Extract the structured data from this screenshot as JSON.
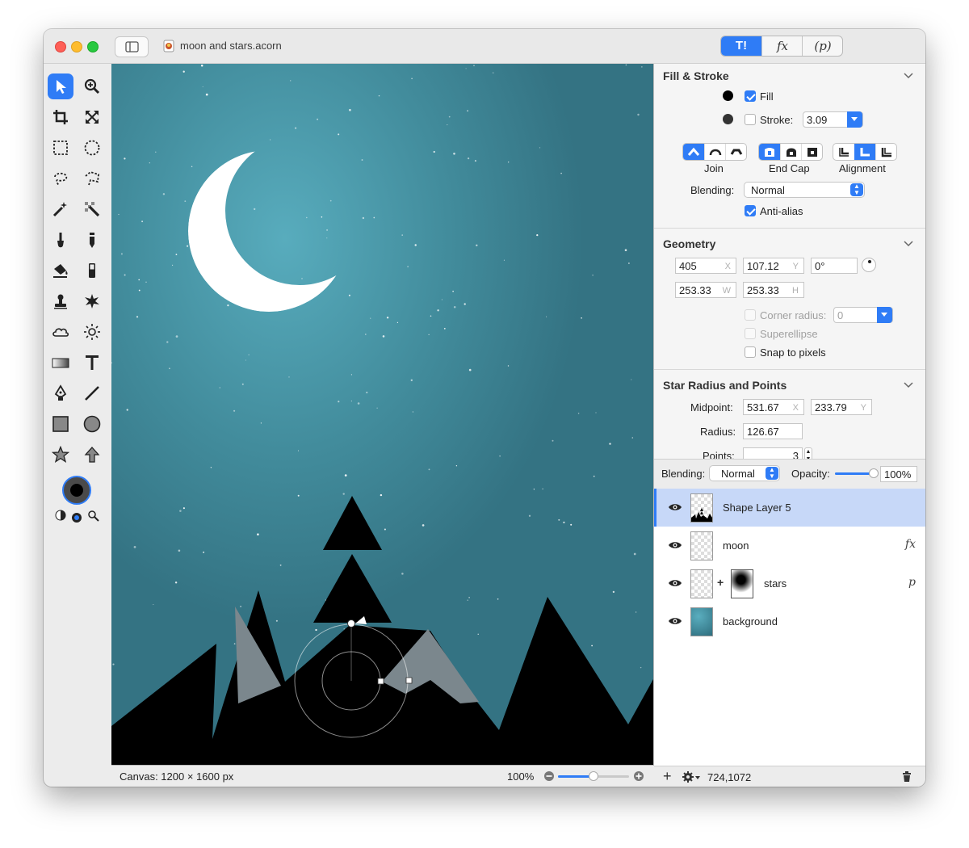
{
  "window": {
    "title": "moon and stars.acorn",
    "mode_tabs": [
      "T!",
      "fx",
      "(p)"
    ]
  },
  "tools": [
    {
      "name": "select-tool",
      "icon": "arrow-pointer-icon",
      "selected": true
    },
    {
      "name": "zoom-tool",
      "icon": "magnifier-plus-icon"
    },
    {
      "name": "crop-tool",
      "icon": "crop-icon"
    },
    {
      "name": "transform-tool",
      "icon": "expand-arrows-icon"
    },
    {
      "name": "rect-select-tool",
      "icon": "dashed-rectangle-icon"
    },
    {
      "name": "ellipse-select-tool",
      "icon": "dashed-circle-icon"
    },
    {
      "name": "lasso-tool",
      "icon": "lasso-icon"
    },
    {
      "name": "polygon-lasso-tool",
      "icon": "polygon-lasso-icon"
    },
    {
      "name": "magic-wand-tool",
      "icon": "magic-wand-icon"
    },
    {
      "name": "instant-alpha-tool",
      "icon": "checker-wand-icon"
    },
    {
      "name": "brush-tool",
      "icon": "brush-icon"
    },
    {
      "name": "pencil-tool",
      "icon": "pencil-icon"
    },
    {
      "name": "paint-bucket-tool",
      "icon": "bucket-icon"
    },
    {
      "name": "eraser-tool",
      "icon": "eraser-icon"
    },
    {
      "name": "clone-tool",
      "icon": "stamp-icon"
    },
    {
      "name": "retouch-tool",
      "icon": "sparkle-icon"
    },
    {
      "name": "cloud-tool",
      "icon": "cloud-icon"
    },
    {
      "name": "sun-tool",
      "icon": "sun-icon"
    },
    {
      "name": "gradient-tool",
      "icon": "gradient-icon"
    },
    {
      "name": "text-tool",
      "icon": "text-t-icon"
    },
    {
      "name": "bezier-pen-tool",
      "icon": "pen-nib-icon"
    },
    {
      "name": "line-tool",
      "icon": "line-icon"
    },
    {
      "name": "rectangle-tool",
      "icon": "square-icon"
    },
    {
      "name": "oval-tool",
      "icon": "circle-icon"
    },
    {
      "name": "star-tool",
      "icon": "star-icon"
    },
    {
      "name": "arrow-tool",
      "icon": "up-arrow-icon"
    }
  ],
  "fill_stroke": {
    "title": "Fill & Stroke",
    "fill_label": "Fill",
    "fill_checked": true,
    "fill_color": "#000000",
    "stroke_label": "Stroke:",
    "stroke_checked": false,
    "stroke_color": "#333333",
    "stroke_width": "3.09",
    "join_label": "Join",
    "end_cap_label": "End Cap",
    "alignment_label": "Alignment",
    "blending_label": "Blending:",
    "blending_value": "Normal",
    "antialias_label": "Anti-alias",
    "antialias_checked": true
  },
  "geometry": {
    "title": "Geometry",
    "x": "405",
    "x_unit": "X",
    "y": "107.12",
    "y_unit": "Y",
    "angle": "0°",
    "w": "253.33",
    "w_unit": "W",
    "h": "253.33",
    "h_unit": "H",
    "corner_radius_label": "Corner radius:",
    "corner_radius_value": "0",
    "superellipse_label": "Superellipse",
    "snap_label": "Snap to pixels"
  },
  "star": {
    "title": "Star Radius and Points",
    "midpoint_label": "Midpoint:",
    "mid_x": "531.67",
    "mid_x_unit": "X",
    "mid_y": "233.79",
    "mid_y_unit": "Y",
    "radius_label": "Radius:",
    "radius": "126.67",
    "points_label": "Points:",
    "points": "3"
  },
  "layers_bar": {
    "blending_label": "Blending:",
    "blending_value": "Normal",
    "opacity_label": "Opacity:",
    "opacity_value": "100%",
    "opacity_fraction": 1.0
  },
  "layers": [
    {
      "name": "Shape Layer 5",
      "selected": true,
      "badge": ""
    },
    {
      "name": "moon",
      "selected": false,
      "badge": "fx"
    },
    {
      "name": "stars",
      "selected": false,
      "badge": "p"
    },
    {
      "name": "background",
      "selected": false,
      "badge": ""
    }
  ],
  "status": {
    "canvas_size": "Canvas: 1200 × 1600 px",
    "zoom": "100%",
    "zoom_fraction": 0.5,
    "cursor": "724,1072"
  },
  "colors": {
    "accent": "#2f7cf6",
    "canvas_bg": "#3b7b8b",
    "selected_layer": "#c7d8f8"
  }
}
